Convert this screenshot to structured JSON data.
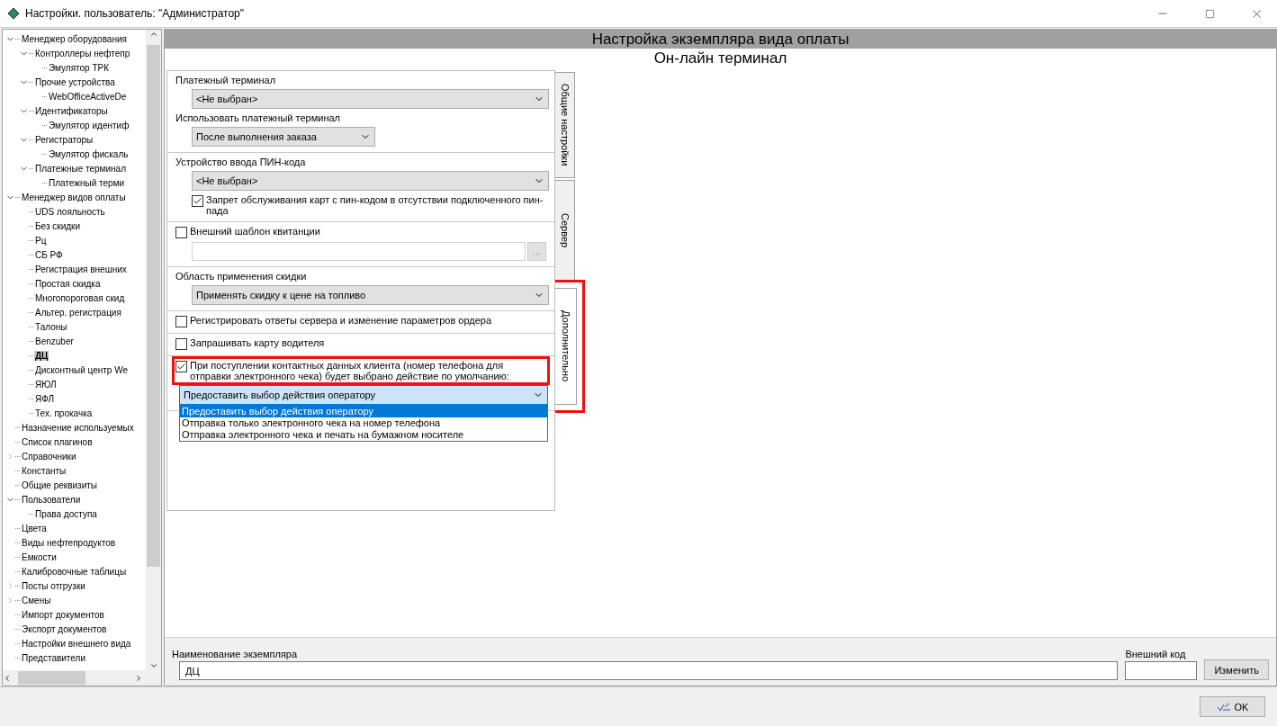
{
  "window": {
    "title": "Настройки. пользователь: \"Администратор\""
  },
  "tree": [
    {
      "label": "Менеджер оборудования",
      "expanded": true,
      "selected": false,
      "children": [
        {
          "label": "Контроллеры нефтепр",
          "expanded": true,
          "selected": false,
          "children": [
            {
              "label": "Эмулятор ТРК",
              "selected": false
            }
          ]
        },
        {
          "label": "Прочие устройства",
          "expanded": true,
          "selected": false,
          "children": [
            {
              "label": "WebOfficeActiveDe",
              "selected": false
            }
          ]
        },
        {
          "label": "Идентификаторы",
          "expanded": true,
          "selected": false,
          "children": [
            {
              "label": "Эмулятор идентиф",
              "selected": false
            }
          ]
        },
        {
          "label": "Регистраторы",
          "expanded": true,
          "selected": false,
          "children": [
            {
              "label": "Эмулятор фискаль",
              "selected": false
            }
          ]
        },
        {
          "label": "Платежные терминал",
          "expanded": true,
          "selected": false,
          "children": [
            {
              "label": "Платежный терми",
              "selected": false
            }
          ]
        }
      ]
    },
    {
      "label": "Менеджер видов оплаты",
      "expanded": true,
      "selected": false,
      "children": [
        {
          "label": "UDS лояльность",
          "selected": false
        },
        {
          "label": "Без скидки",
          "selected": false
        },
        {
          "label": "Рц",
          "selected": false
        },
        {
          "label": "СБ РФ",
          "selected": false
        },
        {
          "label": "Регистрация внешних",
          "selected": false
        },
        {
          "label": "Простая скидка",
          "selected": false
        },
        {
          "label": "Многопороговая скид",
          "selected": false
        },
        {
          "label": "Альтер. регистрация",
          "selected": false
        },
        {
          "label": "Талоны",
          "selected": false
        },
        {
          "label": "Benzuber",
          "selected": false
        },
        {
          "label": "ДЦ",
          "selected": true
        },
        {
          "label": "Дисконтный центр We",
          "selected": false
        },
        {
          "label": "ЯЮЛ",
          "selected": false
        },
        {
          "label": "ЯФЛ",
          "selected": false
        },
        {
          "label": "Тех. прокачка",
          "selected": false
        }
      ]
    },
    {
      "label": "Назначение используемых",
      "selected": false
    },
    {
      "label": "Список плагинов",
      "selected": false
    },
    {
      "label": "Справочники",
      "expanded": false,
      "selected": false
    },
    {
      "label": "Константы",
      "selected": false
    },
    {
      "label": "Общие реквизиты",
      "selected": false
    },
    {
      "label": "Пользователи",
      "expanded": true,
      "selected": false,
      "children": [
        {
          "label": "Права доступа",
          "selected": false
        }
      ]
    },
    {
      "label": "Цвета",
      "selected": false
    },
    {
      "label": "Виды нефтепродуктов",
      "selected": false
    },
    {
      "label": "Емкости",
      "selected": false
    },
    {
      "label": "Калибровочные таблицы",
      "selected": false
    },
    {
      "label": "Посты отгрузки",
      "expanded": false,
      "selected": false
    },
    {
      "label": "Смены",
      "expanded": false,
      "selected": false
    },
    {
      "label": "Импорт документов",
      "selected": false
    },
    {
      "label": "Экспорт документов",
      "selected": false
    },
    {
      "label": "Настройки внешнего вида",
      "selected": false
    },
    {
      "label": "Представители",
      "selected": false
    }
  ],
  "header": {
    "title": "Настройка экземпляра вида оплаты",
    "subtitle": "Он-лайн терминал"
  },
  "sections": [
    {
      "rows": [
        {
          "kind": "label",
          "text": "Платежный терминал"
        },
        {
          "kind": "select",
          "value": "<Не выбран>"
        },
        {
          "kind": "label",
          "text": "Использовать платежный терминал"
        },
        {
          "kind": "compact_select",
          "value": "После выполнения заказа"
        }
      ]
    },
    {
      "rows": [
        {
          "kind": "label",
          "text": "Устройство ввода ПИН-кода"
        },
        {
          "kind": "select",
          "value": "<Не выбран>"
        },
        {
          "kind": "sub_checkbox",
          "text": "Запрет обслуживания карт с пин-кодом в отсутствии подключенного пин-пада",
          "checked": true
        }
      ]
    },
    {
      "rows": [
        {
          "kind": "checkbox",
          "text": "Внешний шаблон квитанции",
          "checked": false
        },
        {
          "kind": "file",
          "value": "",
          "button": "…"
        }
      ]
    },
    {
      "rows": [
        {
          "kind": "label",
          "text": "Область применения скидки"
        },
        {
          "kind": "select",
          "value": "Применять скидку к цене на топливо"
        }
      ]
    },
    {
      "rows": [
        {
          "kind": "checkbox",
          "text": "Регистрировать ответы сервера и изменение параметров ордера",
          "checked": false
        }
      ]
    },
    {
      "rows": [
        {
          "kind": "checkbox",
          "text": "Запрашивать карту водителя",
          "checked": false
        }
      ]
    },
    {
      "rows": [
        {
          "kind": "checkbox",
          "text": "При поступлении контактных данных клиента (номер телефона для отправки электронного чека) будет выбрано действие по умолчанию:",
          "checked": true,
          "highlighted": true
        },
        {
          "kind": "open_select",
          "value": "Предоставить выбор действия оператору",
          "options": [
            {
              "label": "Предоставить выбор действия оператору",
              "selected": true
            },
            {
              "label": "Отправка только электронного чека на номер телефона",
              "selected": false
            },
            {
              "label": "Отправка электронного чека и печать на бумажном носителе",
              "selected": false
            }
          ]
        }
      ]
    }
  ],
  "tabs": [
    {
      "label": "Общие настройки",
      "selected": false,
      "highlighted": false
    },
    {
      "label": "Сервер",
      "selected": false,
      "highlighted": false
    },
    {
      "label": "Дополнительно",
      "selected": true,
      "highlighted": true
    }
  ],
  "instance": {
    "name_label": "Наименование экземпляра",
    "name": "ДЦ",
    "code_label": "Внешний код",
    "change_button": "Изменить"
  },
  "footer": {
    "ok_button": "OK"
  }
}
